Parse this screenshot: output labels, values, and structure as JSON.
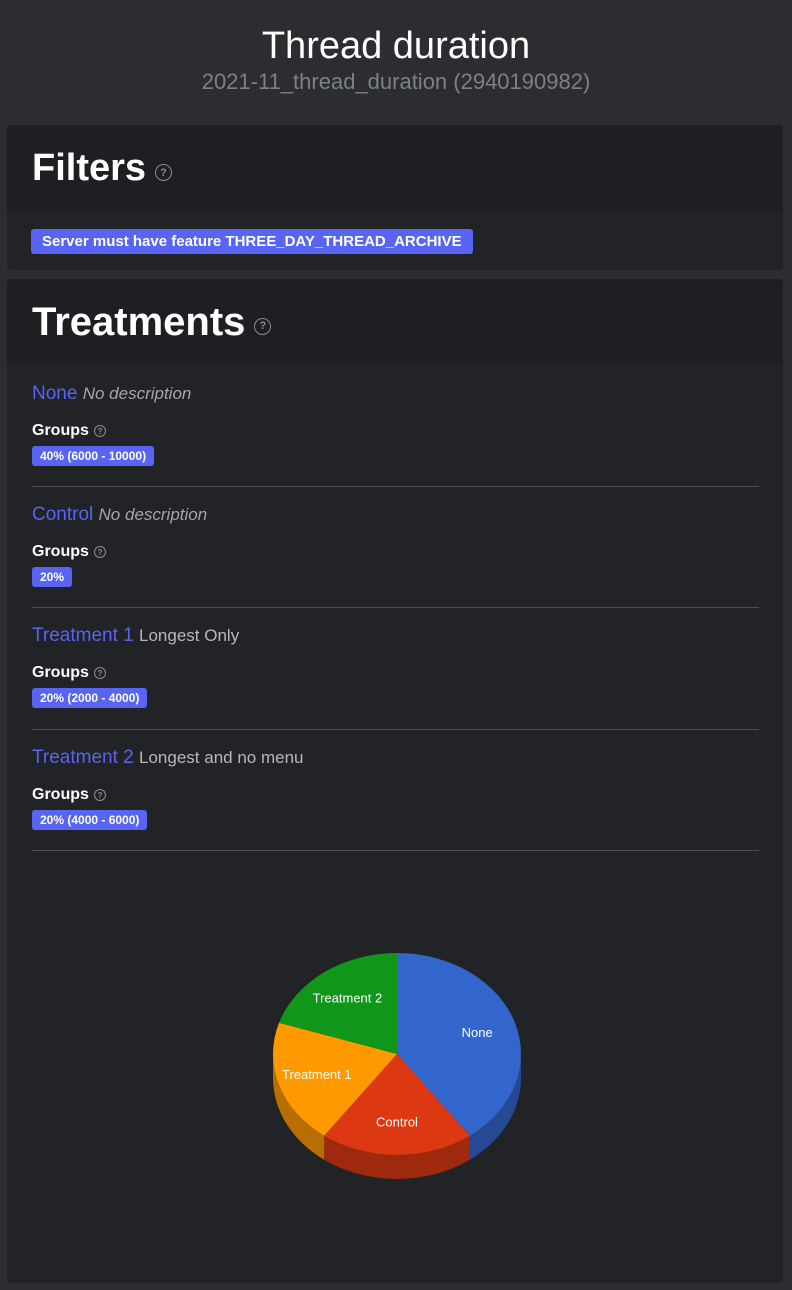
{
  "header": {
    "title": "Thread duration",
    "subtitle": "2021-11_thread_duration (2940190982)"
  },
  "filters": {
    "title": "Filters",
    "help": "?",
    "items": [
      "Server must have feature THREE_DAY_THREAD_ARCHIVE"
    ]
  },
  "treatments": {
    "title": "Treatments",
    "help": "?",
    "groups_label": "Groups",
    "items": [
      {
        "name": "None",
        "description": "No description",
        "description_italic": true,
        "group": "40% (6000 - 10000)"
      },
      {
        "name": "Control",
        "description": "No description",
        "description_italic": true,
        "group": "20%"
      },
      {
        "name": "Treatment 1",
        "description": "Longest Only",
        "description_italic": false,
        "group": "20% (2000 - 4000)"
      },
      {
        "name": "Treatment 2",
        "description": "Longest and no menu",
        "description_italic": false,
        "group": "20% (4000 - 6000)"
      }
    ]
  },
  "chart_data": {
    "type": "pie",
    "labels": [
      "None",
      "Control",
      "Treatment 1",
      "Treatment 2"
    ],
    "values": [
      40,
      20,
      20,
      20
    ],
    "colors": [
      "#3366cc",
      "#dc3912",
      "#ff9900",
      "#109618"
    ],
    "three_d": true
  }
}
